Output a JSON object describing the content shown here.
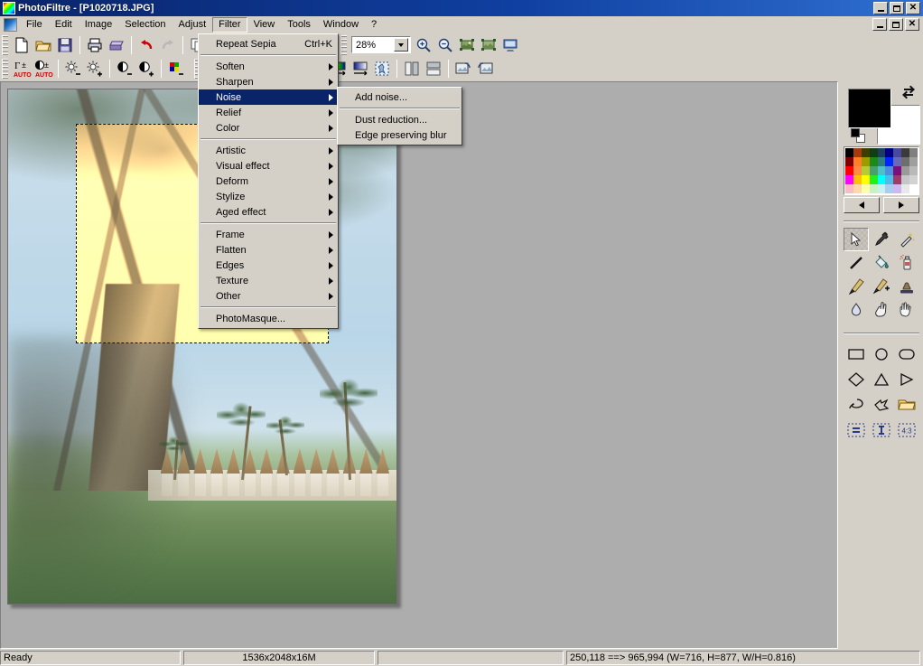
{
  "window": {
    "title": "PhotoFiltre - [P1020718.JPG]",
    "app_icon": "photofiltre-logo-icon",
    "controls": {
      "minimize": "_",
      "maximize": "□",
      "close": "✕"
    }
  },
  "menubar": {
    "items": [
      {
        "label": "File",
        "name": "menu-file"
      },
      {
        "label": "Edit",
        "name": "menu-edit"
      },
      {
        "label": "Image",
        "name": "menu-image"
      },
      {
        "label": "Selection",
        "name": "menu-selection"
      },
      {
        "label": "Adjust",
        "name": "menu-adjust"
      },
      {
        "label": "Filter",
        "name": "menu-filter",
        "open": true
      },
      {
        "label": "View",
        "name": "menu-view"
      },
      {
        "label": "Tools",
        "name": "menu-tools"
      },
      {
        "label": "Window",
        "name": "menu-window"
      },
      {
        "label": "?",
        "name": "menu-help"
      }
    ]
  },
  "filter_menu": {
    "items": [
      {
        "label": "Repeat Sepia",
        "shortcut": "Ctrl+K",
        "submenu": false,
        "highlight": false
      },
      {
        "separator": true
      },
      {
        "label": "Soften",
        "submenu": true
      },
      {
        "label": "Sharpen",
        "submenu": true
      },
      {
        "label": "Noise",
        "submenu": true,
        "highlight": true
      },
      {
        "label": "Relief",
        "submenu": true
      },
      {
        "label": "Color",
        "submenu": true
      },
      {
        "separator": true
      },
      {
        "label": "Artistic",
        "submenu": true
      },
      {
        "label": "Visual effect",
        "submenu": true
      },
      {
        "label": "Deform",
        "submenu": true
      },
      {
        "label": "Stylize",
        "submenu": true
      },
      {
        "label": "Aged effect",
        "submenu": true
      },
      {
        "separator": true
      },
      {
        "label": "Frame",
        "submenu": true
      },
      {
        "label": "Flatten",
        "submenu": true
      },
      {
        "label": "Edges",
        "submenu": true
      },
      {
        "label": "Texture",
        "submenu": true
      },
      {
        "label": "Other",
        "submenu": true
      },
      {
        "separator": true
      },
      {
        "label": "PhotoMasque...",
        "submenu": false
      }
    ]
  },
  "noise_submenu": {
    "items": [
      {
        "label": "Add noise..."
      },
      {
        "separator": true
      },
      {
        "label": "Dust reduction..."
      },
      {
        "label": "Edge preserving blur"
      }
    ]
  },
  "toolbar_row1": {
    "buttons": [
      {
        "name": "new-icon"
      },
      {
        "name": "open-icon"
      },
      {
        "name": "save-icon"
      },
      {
        "sep": true
      },
      {
        "name": "print-icon"
      },
      {
        "name": "scan-icon"
      },
      {
        "sep": true
      },
      {
        "name": "undo-icon"
      },
      {
        "name": "redo-icon"
      },
      {
        "sep": true
      },
      {
        "name": "copy-icon"
      },
      {
        "name": "paste-icon"
      },
      {
        "sep": true
      },
      {
        "name": "text-icon"
      },
      {
        "sep": true
      },
      {
        "name": "layers-icon"
      },
      {
        "name": "palette-icon"
      },
      {
        "name": "thumbnail-icon"
      }
    ],
    "zoom": {
      "value": "28%",
      "name": "zoom-combo"
    },
    "zoom_buttons": [
      {
        "name": "zoom-in-icon"
      },
      {
        "name": "zoom-out-icon"
      },
      {
        "name": "fit-image-icon"
      },
      {
        "name": "actual-size-icon"
      },
      {
        "name": "fullscreen-icon"
      }
    ]
  },
  "toolbar_row2": {
    "buttons": [
      {
        "name": "auto-levels-icon"
      },
      {
        "name": "auto-contrast-icon"
      },
      {
        "sep": true
      },
      {
        "name": "brightness-down-icon"
      },
      {
        "name": "brightness-up-icon"
      },
      {
        "sep": true
      },
      {
        "name": "contrast-down-icon"
      },
      {
        "name": "contrast-up-icon"
      },
      {
        "sep": true
      },
      {
        "name": "color-balance-icon"
      },
      {
        "sep": true
      },
      {
        "name": "grayscale-icon"
      },
      {
        "sep": true
      },
      {
        "name": "transparency-icon"
      },
      {
        "name": "blur-icon"
      },
      {
        "name": "blur-more-icon"
      },
      {
        "sep": true
      },
      {
        "name": "sharpen-icon"
      },
      {
        "name": "sharpen-more-icon"
      },
      {
        "sep": true
      },
      {
        "name": "gradient-icon"
      },
      {
        "name": "linear-gradient-icon"
      },
      {
        "name": "outline-icon"
      },
      {
        "sep": true
      },
      {
        "name": "flip-horizontal-icon"
      },
      {
        "name": "flip-vertical-icon"
      },
      {
        "sep": true
      },
      {
        "name": "rotate-left-icon"
      },
      {
        "name": "rotate-right-icon"
      }
    ]
  },
  "color_panel": {
    "foreground": "#000000",
    "background": "#ffffff",
    "swap_icon": "swap-colors-icon",
    "reset_icon": "default-colors-icon",
    "prev_label": "◀",
    "next_label": "▶",
    "palette": [
      "#000000",
      "#a33b0a",
      "#3d3d00",
      "#123d12",
      "#1c3c60",
      "#000080",
      "#48489e",
      "#3a3a3a",
      "#808080",
      "#7b0000",
      "#ff7f27",
      "#9c9c00",
      "#1a8a1a",
      "#2e7d80",
      "#0026ff",
      "#6a6ab4",
      "#6e6e6e",
      "#9f9f9f",
      "#ff0000",
      "#ff8c42",
      "#b5cc34",
      "#49a06f",
      "#4fc0c8",
      "#4f8fe0",
      "#7d0f7d",
      "#9a9a9a",
      "#b9b9b9",
      "#ff00ff",
      "#ffc000",
      "#ffff00",
      "#22ee22",
      "#00ffff",
      "#4fbde8",
      "#9e3b6a",
      "#c6c6c6",
      "#d2d2d2",
      "#ffb8c8",
      "#ffd9a8",
      "#ffffa8",
      "#c8f2c0",
      "#c5eff0",
      "#a8cdf0",
      "#cdb8f0",
      "#e8e8e8",
      "#ffffff"
    ]
  },
  "tool_palette": {
    "tools": [
      {
        "name": "select-tool",
        "selected": true
      },
      {
        "name": "eyedropper-tool"
      },
      {
        "name": "magic-wand-tool"
      },
      {
        "name": "line-tool"
      },
      {
        "name": "paint-bucket-tool"
      },
      {
        "name": "spray-tool"
      },
      {
        "name": "paintbrush-tool"
      },
      {
        "name": "advanced-brush-tool"
      },
      {
        "name": "stamp-tool"
      },
      {
        "name": "waterdrop-tool"
      },
      {
        "name": "smudge-tool"
      },
      {
        "name": "hand-tool"
      }
    ],
    "shapes": [
      {
        "name": "rectangle-selection"
      },
      {
        "name": "ellipse-selection"
      },
      {
        "name": "rounded-rectangle-selection"
      },
      {
        "name": "diamond-selection"
      },
      {
        "name": "triangle-selection"
      },
      {
        "name": "right-triangle-selection"
      },
      {
        "name": "lasso-selection"
      },
      {
        "name": "polygon-selection"
      },
      {
        "name": "load-selection"
      },
      {
        "name": "equal-ratio-selection"
      },
      {
        "name": "fixed-size-selection"
      },
      {
        "name": "aspect-4-3-selection"
      }
    ]
  },
  "statusbar": {
    "status": "Ready",
    "image_info": "1536x2048x16M",
    "extra": "",
    "coords": "250,118 ==> 965,994 (W=716, H=877, W/H=0.816)"
  },
  "document": {
    "filename": "P1020718.JPG",
    "zoom": "28%",
    "scene": "tropical beach with large tree, palms and thatched cabanas",
    "selection": {
      "label": "sepia-filtered-selection"
    }
  }
}
